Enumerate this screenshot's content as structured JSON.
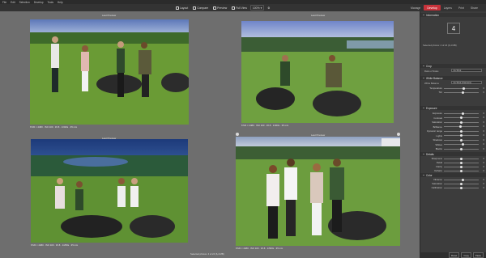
{
  "menu": [
    "File",
    "Edit",
    "Selection",
    "Develop",
    "Tools",
    "Help"
  ],
  "toolbar": {
    "tools": [
      "Layout",
      "Compare",
      "Preview",
      "Full View"
    ],
    "zoom": "100%",
    "modes": [
      "Manage",
      "Develop",
      "Layers",
      "Print",
      "Share"
    ],
    "active_mode": "Develop"
  },
  "viewer": {
    "cells": [
      {
        "title": "Last Preview",
        "caption": "6720 × 4480 · ISO 100 · f/2.8 · 1/320s · 35 mm"
      },
      {
        "title": "Last Preview",
        "caption": "6720 × 4480 · ISO 100 · f/2.8 · 1/400s · 35 mm"
      },
      {
        "title": "Last Preview",
        "caption": "6720 × 4480 · ISO 100 · f/2.8 · 1/250s · 35 mm"
      },
      {
        "title": "Last Preview",
        "caption": "6720 × 4480 · ISO 100 · f/2.8 · 1/500s · 35 mm"
      }
    ],
    "status": "Selected photos: 4 of 24 (6,4 MB)"
  },
  "panel": {
    "info_title": "Information",
    "count": "4",
    "info_line": "Selected photos: 4 of 24 (6,4 MB)",
    "crop_title": "Crop",
    "crop_label": "Ratio of Sides",
    "crop_value": "As Shot",
    "wb_title": "White Balance",
    "wb_label": "White Balance",
    "wb_value": "As Shot (Camera)",
    "wb_sliders": [
      {
        "label": "Temperature",
        "value": "0",
        "pos": 0.58
      },
      {
        "label": "Tint",
        "value": "0",
        "pos": 0.55
      }
    ],
    "exposure_title": "Exposure",
    "exposure_sliders": [
      {
        "label": "Exposure",
        "value": "0",
        "pos": 0.55
      },
      {
        "label": "Contrast",
        "value": "0",
        "pos": 0.5
      },
      {
        "label": "Saturation",
        "value": "0",
        "pos": 0.5
      },
      {
        "label": "Brilliance",
        "value": "0",
        "pos": 0.48
      },
      {
        "label": "Dynamic range",
        "value": "0",
        "pos": 0.5
      },
      {
        "label": "Lights",
        "value": "0",
        "pos": 0.5
      },
      {
        "label": "Shadows",
        "value": "0",
        "pos": 0.5
      },
      {
        "label": "Whites",
        "value": "0",
        "pos": 0.55
      },
      {
        "label": "Blacks",
        "value": "0",
        "pos": 0.5
      }
    ],
    "details_title": "Details",
    "details_sliders": [
      {
        "label": "Sharpness",
        "value": "0",
        "pos": 0.5
      },
      {
        "label": "Detail",
        "value": "0",
        "pos": 0.5
      },
      {
        "label": "Clarity",
        "value": "0",
        "pos": 0.5
      },
      {
        "label": "Dehaze",
        "value": "0",
        "pos": 0.5
      }
    ],
    "color_title": "Color",
    "color_sliders": [
      {
        "label": "Vibrance",
        "value": "0",
        "pos": 0.55
      },
      {
        "label": "Saturation",
        "value": "0",
        "pos": 0.5
      },
      {
        "label": "Calibration",
        "value": "0",
        "pos": 0.5
      }
    ],
    "footer": [
      "Reset",
      "Copy",
      "Paste"
    ]
  }
}
